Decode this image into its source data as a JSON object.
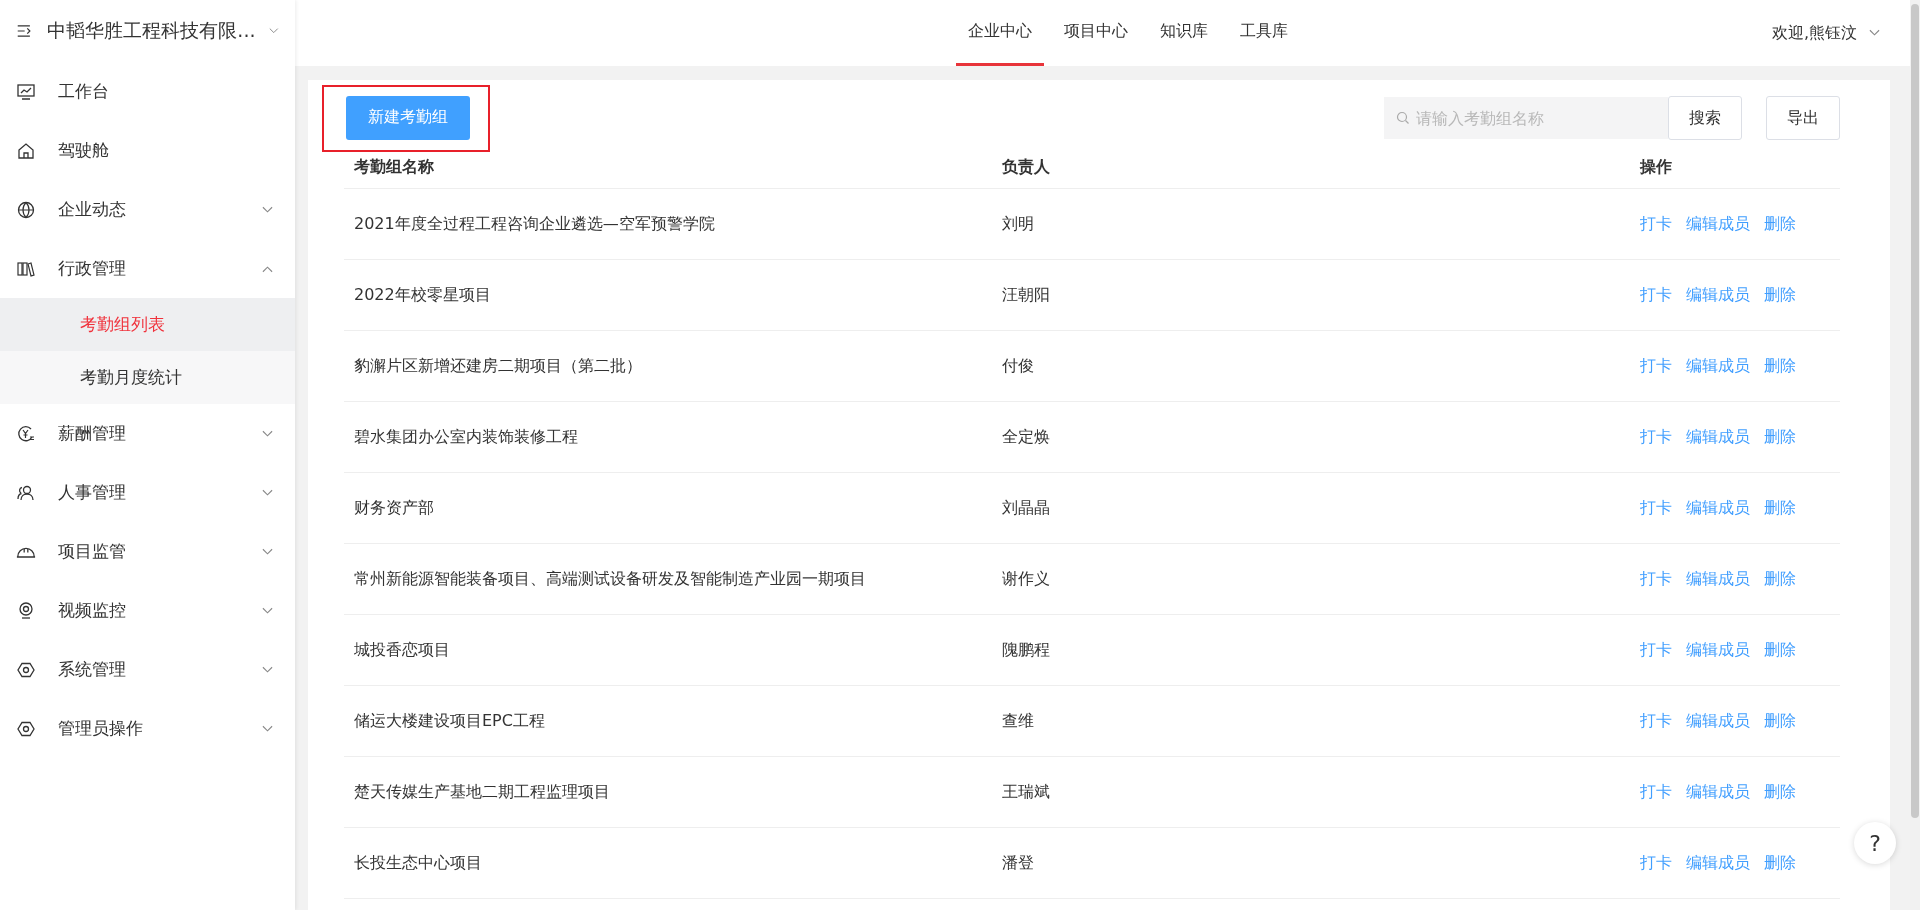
{
  "sidebar": {
    "company": "中韬华胜工程科技有限...",
    "items": [
      {
        "label": "工作台"
      },
      {
        "label": "驾驶舱"
      },
      {
        "label": "企业动态",
        "expanded": false
      },
      {
        "label": "行政管理",
        "expanded": true,
        "children": [
          {
            "label": "考勤组列表",
            "selected": true
          },
          {
            "label": "考勤月度统计",
            "selected": false
          }
        ]
      },
      {
        "label": "薪酬管理",
        "expanded": false
      },
      {
        "label": "人事管理",
        "expanded": false
      },
      {
        "label": "项目监管",
        "expanded": false
      },
      {
        "label": "视频监控",
        "expanded": false
      },
      {
        "label": "系统管理",
        "expanded": false
      },
      {
        "label": "管理员操作",
        "expanded": false
      }
    ]
  },
  "top_nav": {
    "tabs": [
      {
        "label": "企业中心",
        "selected": true
      },
      {
        "label": "项目中心",
        "selected": false
      },
      {
        "label": "知识库",
        "selected": false
      },
      {
        "label": "工具库",
        "selected": false
      }
    ],
    "user": "欢迎,熊钰汶"
  },
  "toolbar": {
    "new_button": "新建考勤组",
    "search": {
      "placeholder": "请输入考勤组名称"
    },
    "search_button": "搜索",
    "export_button": "导出"
  },
  "table": {
    "columns": [
      "考勤组名称",
      "负责人",
      "操作"
    ],
    "rows": [
      {
        "name": "2021年度全过程工程咨询企业遴选—空军预警学院",
        "owner": "刘明",
        "actions": [
          "打卡",
          "编辑成员",
          "删除"
        ]
      },
      {
        "name": "2022年校零星项目",
        "owner": "汪朝阳",
        "actions": [
          "打卡",
          "编辑成员",
          "删除"
        ]
      },
      {
        "name": "豹澥片区新增还建房二期项目（第二批）",
        "owner": "付俊",
        "actions": [
          "打卡",
          "编辑成员",
          "删除"
        ]
      },
      {
        "name": "碧水集团办公室内装饰装修工程",
        "owner": "全定焕",
        "actions": [
          "打卡",
          "编辑成员",
          "删除"
        ]
      },
      {
        "name": "财务资产部",
        "owner": "刘晶晶",
        "actions": [
          "打卡",
          "编辑成员",
          "删除"
        ]
      },
      {
        "name": "常州新能源智能装备项目、高端测试设备研发及智能制造产业园一期项目",
        "owner": "谢作义",
        "actions": [
          "打卡",
          "编辑成员",
          "删除"
        ]
      },
      {
        "name": "城投香恋项目",
        "owner": "隗鹏程",
        "actions": [
          "打卡",
          "编辑成员",
          "删除"
        ]
      },
      {
        "name": "储运大楼建设项目EPC工程",
        "owner": "查维",
        "actions": [
          "打卡",
          "编辑成员",
          "删除"
        ]
      },
      {
        "name": "楚天传媒生产基地二期工程监理项目",
        "owner": "王瑞斌",
        "actions": [
          "打卡",
          "编辑成员",
          "删除"
        ]
      },
      {
        "name": "长投生态中心项目",
        "owner": "潘登",
        "actions": [
          "打卡",
          "编辑成员",
          "删除"
        ]
      }
    ]
  },
  "help_button": "?"
}
